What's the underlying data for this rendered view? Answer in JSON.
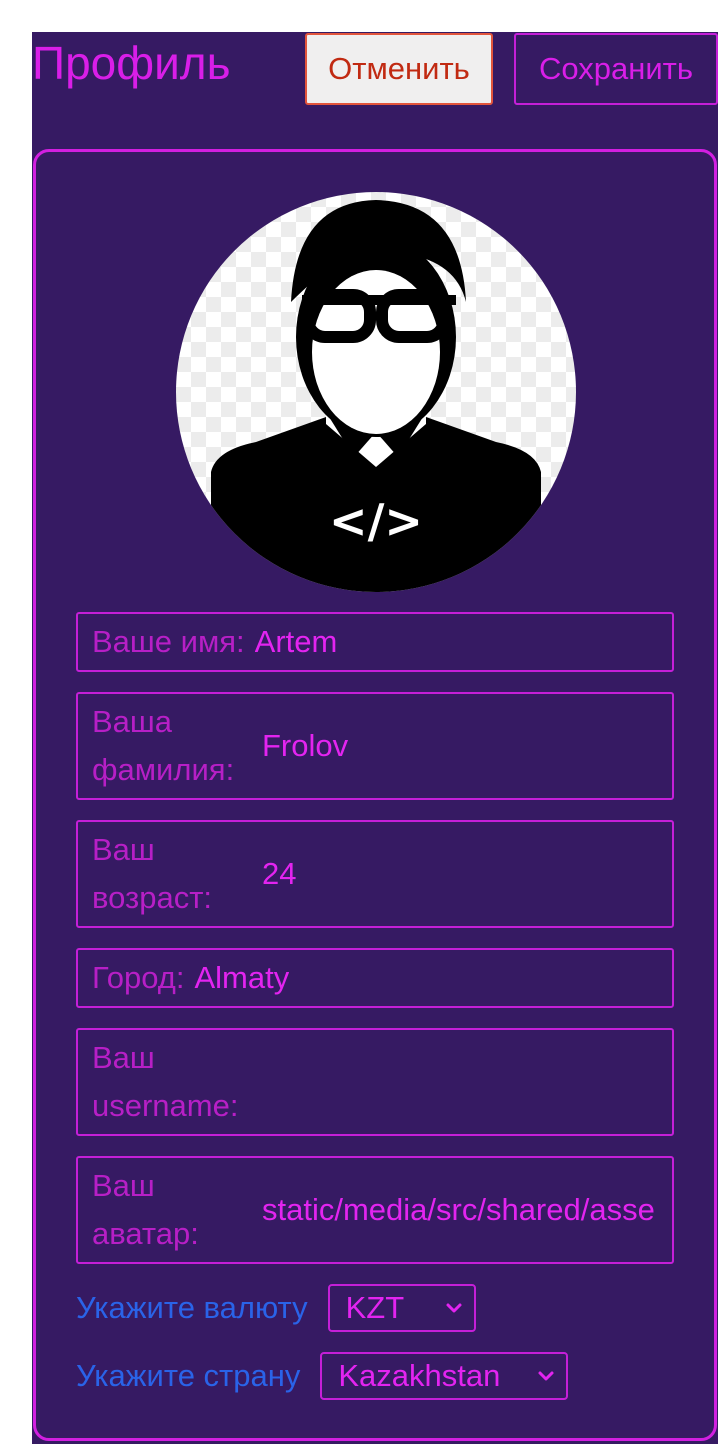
{
  "header": {
    "title": "Профиль",
    "cancel_label": "Отменить",
    "save_label": "Сохранить"
  },
  "profile": {
    "avatar_icon": "developer-avatar-icon",
    "avatar_glyph": "</>",
    "fields": [
      {
        "label": "Ваше имя:",
        "value": "Artem"
      },
      {
        "label": "Ваша фамилия:",
        "value": "Frolov"
      },
      {
        "label": "Ваш возраст:",
        "value": "24"
      },
      {
        "label": "Город:",
        "value": "Almaty"
      },
      {
        "label": "Ваш username:",
        "value": ""
      },
      {
        "label": "Ваш аватар:",
        "value": "static/media/src/shared/asse"
      }
    ]
  },
  "currency": {
    "label": "Укажите валюту",
    "value": "KZT"
  },
  "country": {
    "label": "Укажите страну",
    "value": "Kazakhstan"
  },
  "colors": {
    "panel": "#361a63",
    "accent": "#d91ee8",
    "link_blue": "#2a63e8",
    "cancel_border": "#e2553c"
  }
}
